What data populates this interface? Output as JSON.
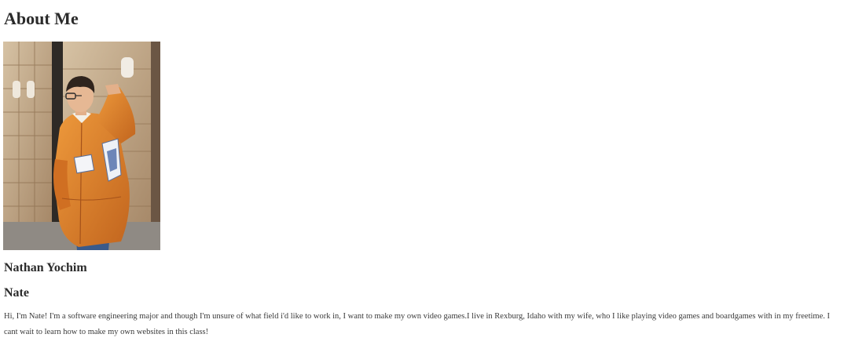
{
  "header": {
    "title": "About Me"
  },
  "profile": {
    "photo_alt": "Photo of Nathan Yochim",
    "full_name": "Nathan Yochim",
    "nickname": "Nate",
    "bio": "Hi, I'm Nate! I'm a software engineering major and though I'm unsure of what field i'd like to work in, I want to make my own video games.I live in Rexburg, Idaho with my wife, who I like playing video games and boardgames with in my freetime. I cant wait to learn how to make my own websites in this class!"
  },
  "colors": {
    "text": "#2b2b2b",
    "background": "#ffffff",
    "jacket": "#d9772a"
  }
}
